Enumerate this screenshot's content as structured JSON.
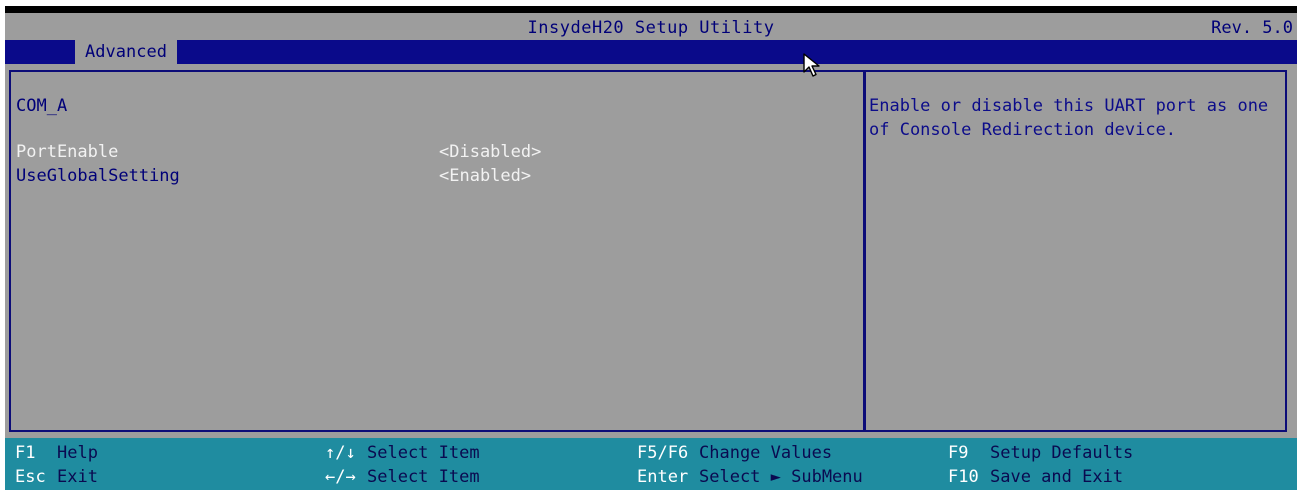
{
  "header": {
    "title": "InsydeH20 Setup Utility",
    "revision": "Rev. 5.0"
  },
  "menu": {
    "tabs": [
      {
        "label": "Advanced",
        "active": true
      }
    ]
  },
  "main": {
    "section_title": "COM_A",
    "settings": [
      {
        "label": "PortEnable",
        "value": "<Disabled>"
      },
      {
        "label": "UseGlobalSetting",
        "value": "<Enabled>"
      }
    ]
  },
  "help": {
    "text": "Enable or disable this UART port as one of Console Redirection device."
  },
  "footer": {
    "keys": [
      {
        "key": "F1",
        "desc": "Help"
      },
      {
        "key": "Esc",
        "desc": "Exit"
      },
      {
        "key": "↑/↓",
        "desc": "Select Item"
      },
      {
        "key": "←/→",
        "desc": "Select Item"
      },
      {
        "key": "F5/F6",
        "desc": "Change Values"
      },
      {
        "key": "Enter",
        "desc": "Select ► SubMenu"
      },
      {
        "key": "F9",
        "desc": "Setup Defaults"
      },
      {
        "key": "F10",
        "desc": "Save and Exit"
      }
    ]
  },
  "colors": {
    "title_bar": "#9d9d9d",
    "title_text": "#000078",
    "menu_bar": "#0a0a8a",
    "content_bg": "#9d9d9d",
    "panel_border": "#0c0c78",
    "footer_bg": "#1f8ca0",
    "highlight_text": "#f2f2f2"
  },
  "icons": {
    "cursor": "mouse-pointer-icon"
  }
}
